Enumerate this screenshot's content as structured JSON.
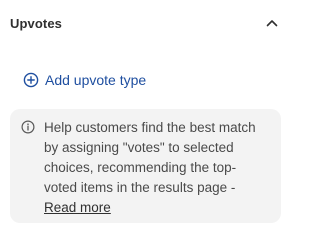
{
  "section": {
    "title": "Upvotes",
    "toggle_icon": "chevron-up-icon"
  },
  "actions": {
    "add_label": "Add upvote type",
    "add_icon": "plus-circle-icon"
  },
  "info": {
    "icon": "info-icon",
    "lines": [
      "Help customers find the best match",
      "by assigning \"votes\" to selected",
      "choices, recommending the top-",
      "voted items in the results page -"
    ],
    "link_label": "Read more"
  },
  "colors": {
    "link": "#1f4fa0",
    "text": "#4a4a4a",
    "box_bg": "#f3f3f3"
  }
}
